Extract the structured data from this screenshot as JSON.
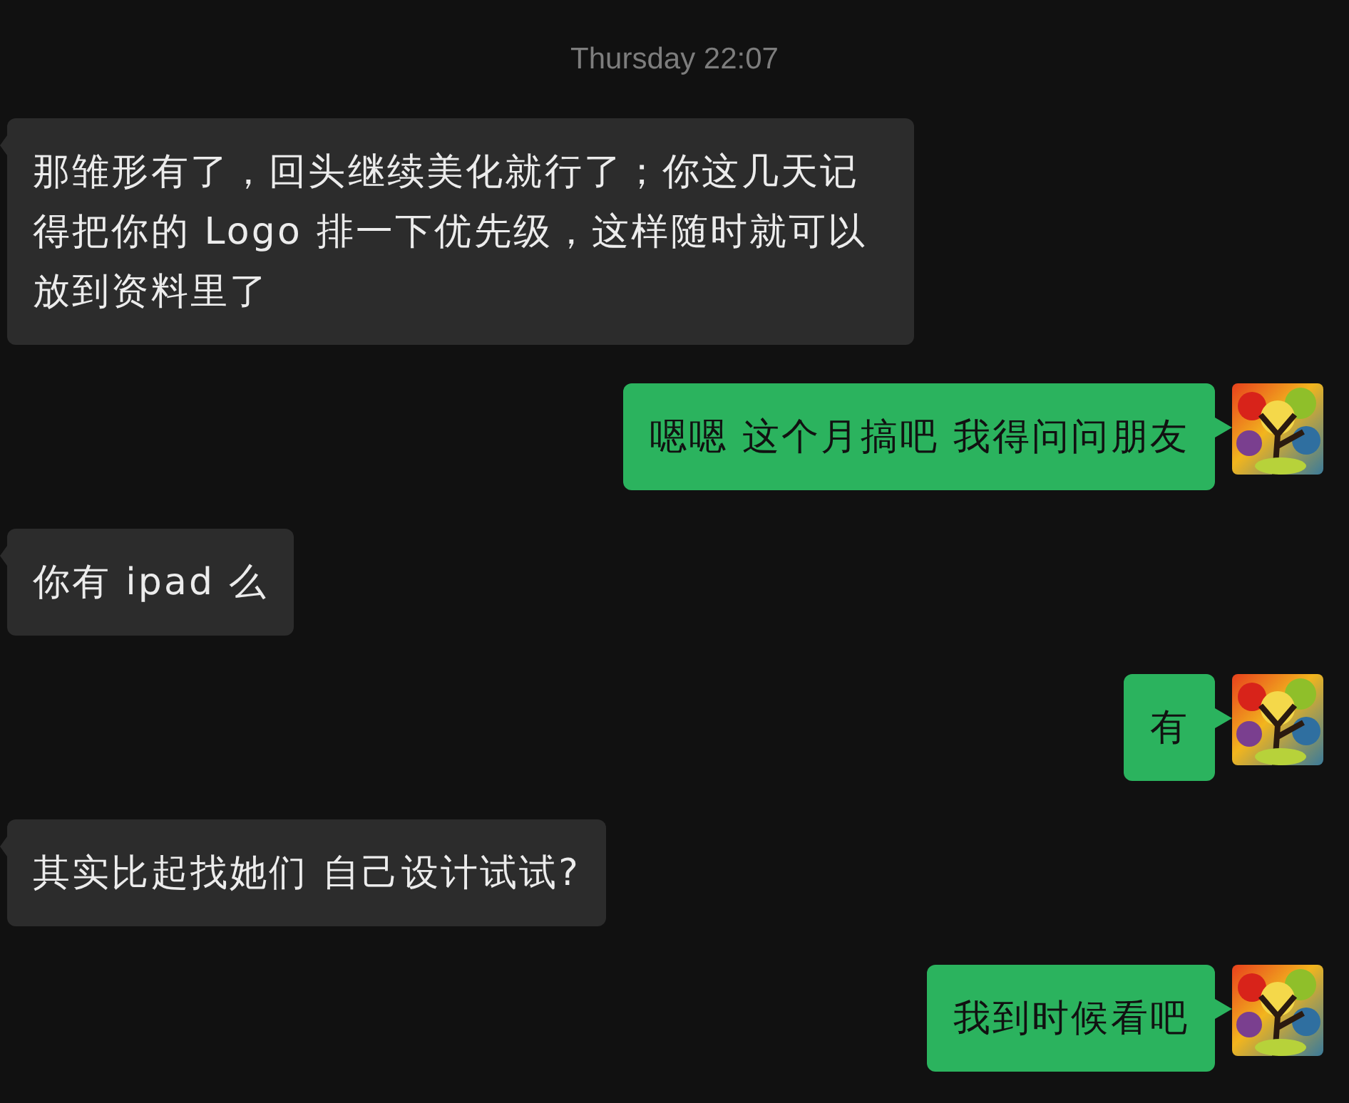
{
  "timestamp": "Thursday 22:07",
  "messages": [
    {
      "kind": "incoming",
      "text": "那雏形有了，回头继续美化就行了；你这几天记得把你的 Logo 排一下优先级，这样随时就可以放到资料里了"
    },
    {
      "kind": "outgoing",
      "text": "嗯嗯 这个月搞吧 我得问问朋友"
    },
    {
      "kind": "incoming",
      "text": "你有 ipad 么"
    },
    {
      "kind": "outgoing",
      "text": "有"
    },
    {
      "kind": "incoming",
      "text": "其实比起找她们 自己设计试试?"
    },
    {
      "kind": "outgoing",
      "text": "我到时候看吧"
    }
  ]
}
